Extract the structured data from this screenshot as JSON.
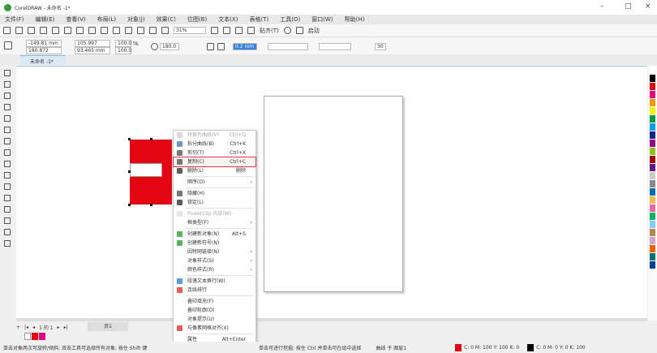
{
  "window": {
    "title": "CorelDRAW - 未命名 -1*",
    "minimize": "–",
    "maximize": "□",
    "close": "×"
  },
  "menubar": [
    "文件(F)",
    "编辑(E)",
    "查看(V)",
    "布局(L)",
    "对象(J)",
    "效果(C)",
    "位图(B)",
    "文本(X)",
    "表格(T)",
    "工具(O)",
    "窗口(W)",
    "帮助(H)"
  ],
  "toolbar": {
    "zoom": "31%",
    "snap": "贴齐(T)",
    "launch": "启动"
  },
  "property_bar": {
    "x": "-149.81 mm",
    "y": "180.872 mm",
    "width": "105.997 mm",
    "height": "93.465 mm",
    "scale_x": "100.0",
    "scale_y": "100.0",
    "pct": "%",
    "angle": "180.0",
    "outline": "0.2 mm",
    "corner": "30"
  },
  "document_tab": "未命名 -1*",
  "context_menu": [
    {
      "label": "转换为曲线(V)",
      "shortcut": "Ctrl+Q",
      "disabled": true,
      "icon": "convert-curve-icon"
    },
    {
      "label": "拆分曲线(B)",
      "shortcut": "Ctrl+K",
      "icon": "break-curve-icon"
    },
    {
      "label": "剪切(T)",
      "shortcut": "Ctrl+X",
      "icon": "cut-icon"
    },
    {
      "label": "复制(C)",
      "shortcut": "Ctrl+C",
      "icon": "copy-icon",
      "highlighted": true
    },
    {
      "label": "删除(L)",
      "shortcut": "删除",
      "icon": "trash-icon"
    },
    {
      "sep": true
    },
    {
      "label": "顺序(O)",
      "submenu": true
    },
    {
      "sep": true
    },
    {
      "label": "隐藏(H)",
      "icon": "hide-icon"
    },
    {
      "label": "锁定(L)",
      "icon": "lock-icon"
    },
    {
      "sep": true
    },
    {
      "label": "PowerClip 内部(W)",
      "disabled": true,
      "icon": "powerclip-icon"
    },
    {
      "label": "框类型(F)",
      "submenu": true
    },
    {
      "sep": true
    },
    {
      "label": "创建新对象(N)",
      "shortcut": "Alt+S",
      "icon": "new-object-icon"
    },
    {
      "label": "创建新符号(N)",
      "icon": "new-symbol-icon"
    },
    {
      "label": "因特网链接(N)",
      "submenu": true
    },
    {
      "label": "对象样式(S)",
      "submenu": true
    },
    {
      "label": "颜色样式(R)",
      "submenu": true
    },
    {
      "sep": true
    },
    {
      "label": "段落文本换行(W)",
      "icon": "text-wrap-icon"
    },
    {
      "label": "连线排行",
      "icon": "connector-icon"
    },
    {
      "sep": true
    },
    {
      "label": "叠印填充(F)"
    },
    {
      "label": "叠印轮廓(O)"
    },
    {
      "label": "对象提示(U)"
    },
    {
      "label": "与像素网格对齐(X)",
      "icon": "pixel-grid-icon"
    },
    {
      "sep": true
    },
    {
      "label": "属性",
      "shortcut": "Alt+Enter"
    }
  ],
  "page_nav": {
    "current": "1 的 1",
    "page_tab": "页1"
  },
  "status": {
    "hint": "单击对象两次可旋转/倾斜; 双击工具可选择所有对象; 按住 Shift 键",
    "hint2": "单击可进行挖掘; 按住 Ctrl 并单击可在组中选择",
    "layer": "曲线 于 图层1",
    "fill": "C: 0 M: 100 Y: 100 K: 0",
    "outline": "C: 0 M: 0 Y: 0 K: 100"
  },
  "colors": {
    "fill": "#e30613",
    "palette": [
      "#ffffff",
      "#000000",
      "#e30613",
      "#e6007e",
      "#f39800",
      "#fff100",
      "#009944",
      "#00a0e9",
      "#1d2088",
      "#920783",
      "#8fc31f",
      "#a40000",
      "#601986",
      "#c9caca",
      "#898989",
      "#036eb8",
      "#f8b551",
      "#ea68a2",
      "#13ae67",
      "#7ecef4",
      "#b28850",
      "#d3a4cd",
      "#eb6100",
      "#00736d",
      "#004098"
    ]
  }
}
